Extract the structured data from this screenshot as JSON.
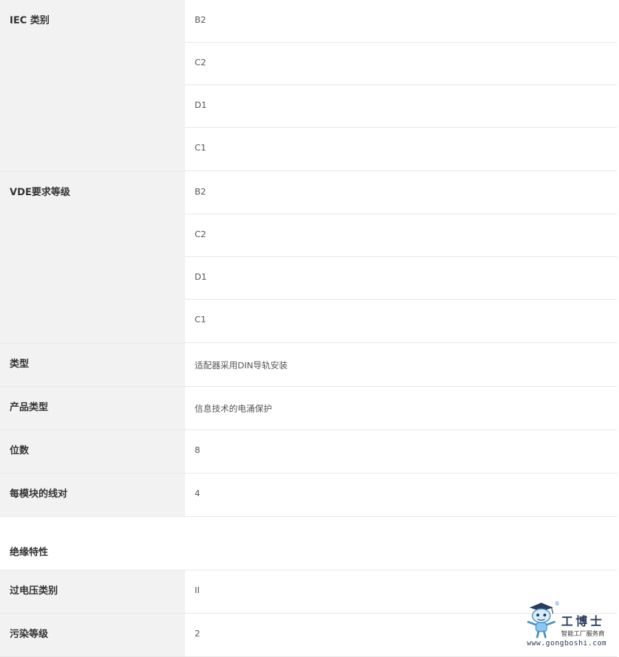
{
  "rows": [
    {
      "label": "IEC 类别",
      "values": [
        "B2",
        "C2",
        "D1",
        "C1"
      ]
    },
    {
      "label": "VDE要求等级",
      "values": [
        "B2",
        "C2",
        "D1",
        "C1"
      ]
    },
    {
      "label": "类型",
      "values": [
        "适配器采用DIN导轨安装"
      ]
    },
    {
      "label": "产品类型",
      "values": [
        "信息技术的电涌保护"
      ]
    },
    {
      "label": "位数",
      "values": [
        "8"
      ]
    },
    {
      "label": "每模块的线对",
      "values": [
        "4"
      ]
    }
  ],
  "section": {
    "title": "绝缘特性"
  },
  "rows2": [
    {
      "label": "过电压类别",
      "values": [
        "II"
      ]
    },
    {
      "label": "污染等级",
      "values": [
        "2"
      ]
    }
  ],
  "watermark": {
    "brand": "工博士",
    "registered": "®",
    "slogan": "智能工厂服务商",
    "url": "www.gongboshi.com",
    "mascot_icon": "robot-mascot-icon",
    "brand_color": "#2a3d5c",
    "accent_color": "#4a90c8"
  }
}
